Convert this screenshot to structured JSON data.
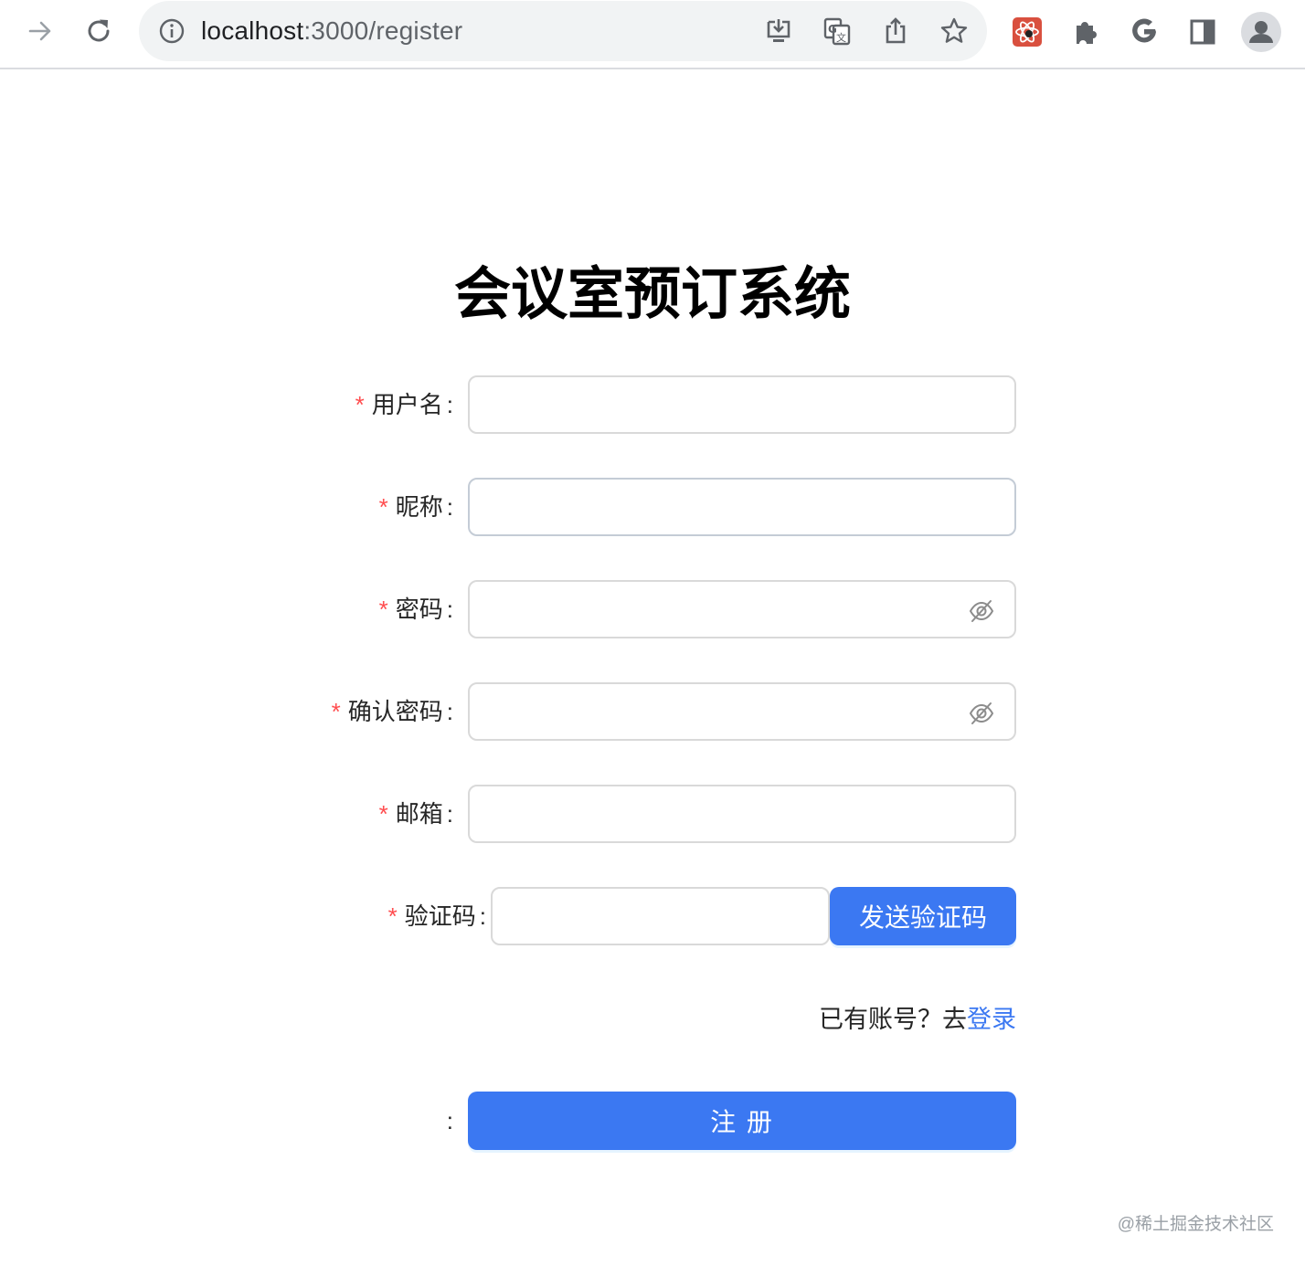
{
  "browser": {
    "url_host": "localhost",
    "url_path": ":3000/register"
  },
  "page": {
    "title": "会议室预订系统",
    "fields": [
      {
        "label": "用户名",
        "value": ""
      },
      {
        "label": "昵称",
        "value": ""
      },
      {
        "label": "密码",
        "value": ""
      },
      {
        "label": "确认密码",
        "value": ""
      },
      {
        "label": "邮箱",
        "value": ""
      },
      {
        "label": "验证码",
        "value": ""
      }
    ],
    "required_mark": "*",
    "colon": ":",
    "send_code_button": "发送验证码",
    "have_account_text": "已有账号？去",
    "login_link": "登录",
    "submit_button": "注 册",
    "submit_label_colon": ":",
    "watermark": "@稀土掘金技术社区"
  },
  "colors": {
    "primary": "#3b78f2",
    "required": "#ff4d4f",
    "border": "#d9d9d9"
  }
}
